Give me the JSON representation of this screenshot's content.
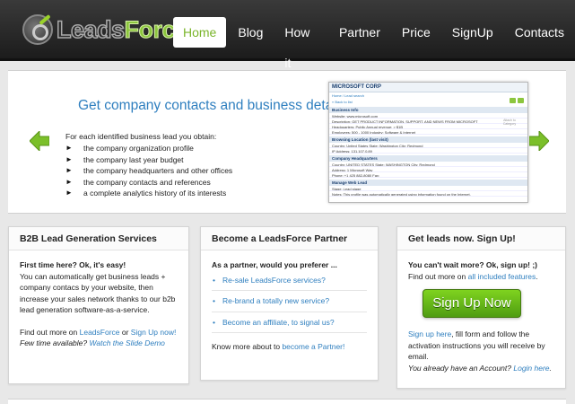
{
  "brand": {
    "part1": "Leads",
    "part2": "Force"
  },
  "nav": [
    {
      "label": "Home"
    },
    {
      "label": "Blog"
    },
    {
      "label": "How it works"
    },
    {
      "label": "Partner"
    },
    {
      "label": "Price"
    },
    {
      "label": "SignUp"
    },
    {
      "label": "Contacts"
    }
  ],
  "hero": {
    "title": "Get company contacts and business details",
    "intro": "For each identified business lead you obtain:",
    "items": [
      "the company  organization profile",
      "the company last year budget",
      "the company headquarters and other offices",
      "the company contacts and references",
      "a complete analytics history of its interests"
    ],
    "mock": {
      "title": "MICROSOFT CORP",
      "sub": "Home / Lead search",
      "back": "« Back to list",
      "section1": "Business Info",
      "s1_lines": [
        "Website: www.microsoft.com",
        "Description: GET PRODUCT INFORMATION, SUPPORT, AND NEWS FROM MICROSOFT",
        "Headquarters: Public          Annual revenue: > $1B",
        "Employees: 500 - 1000          Industry: Software & Internet"
      ],
      "side_note": "Attach to Category",
      "section2": "Browsing Location (last visit)",
      "s2_lines": [
        "Country: United States          State: Washington          City: Redmond",
        "IP Address: 131.107.0.89"
      ],
      "section3": "Company Headquarters",
      "s3_lines": [
        "Country: UNITED STATES          State: WASHINGTON          City: Redmond",
        "Address: 1 Microsoft Way",
        "Phone: +1 425 882-8080          Fax:"
      ],
      "section4": "Manage Web Lead",
      "s4_lines": [
        "Stage:                              Lead stage",
        "Notes: This profile was automatically generated using information found on the Internet."
      ]
    }
  },
  "cards": {
    "b2b": {
      "title": "B2B Lead Generation Services",
      "lead": "First time here? Ok, it's easy!",
      "text": "You can automatically get business leads + company contacs by your website, then increase your sales network thanks to our b2b lead generation software-as-a-service.",
      "find_prefix": "Find out more on ",
      "find_link1": "LeadsForce",
      "find_mid": " or ",
      "find_link2": "Sign Up now!",
      "time_prefix": "Few time available? ",
      "time_link": "Watch the Slide Demo"
    },
    "partner": {
      "title": "Become a LeadsForce Partner",
      "lead": "As a partner, would you preferer ...",
      "options": [
        "Re-sale LeadsForce services?",
        "Re-brand a totally new service?",
        "Become an affiliate, to signal us?"
      ],
      "more_prefix": "Know more about to ",
      "more_link": "become a Partner!"
    },
    "signup": {
      "title": "Get leads now. Sign Up!",
      "lead": "You can't wait more? Ok, sign up! ;)",
      "find_prefix": "Find out more on ",
      "find_link": "all included features",
      "find_suffix": ".",
      "button": "Sign Up Now",
      "inst_link": "Sign up here",
      "inst_text": ", fill form and follow the activation instructions you will receive by email.",
      "account_text": "You already have an Account? ",
      "account_link": "Login here",
      "account_suffix": "."
    }
  },
  "colors": {
    "accent": "#8cc63e",
    "link": "#2f7fbf",
    "header": "#2a2a2a"
  },
  "icons": {
    "prev": "arrow-left-icon",
    "next": "arrow-right-icon"
  }
}
